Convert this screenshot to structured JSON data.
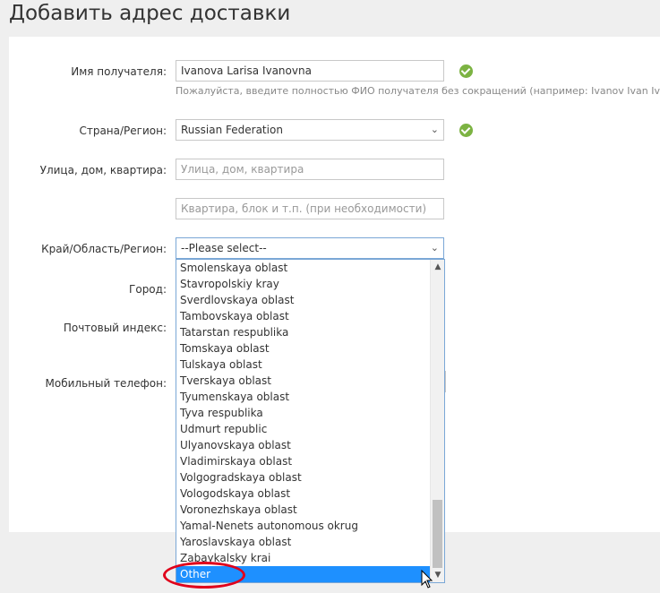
{
  "page_title": "Добавить адрес доставки",
  "form": {
    "name": {
      "label": "Имя получателя:",
      "value": "Ivanova Larisa Ivanovna",
      "hint": "Пожалуйста, введите полностью ФИО получателя без сокращений (например: Ivanov Ivan Iva"
    },
    "country": {
      "label": "Страна/Регион:",
      "value": "Russian Federation"
    },
    "street": {
      "label": "Улица, дом, квартира:",
      "placeholder": "Улица, дом, квартира"
    },
    "apartment": {
      "placeholder": "Квартира, блок и т.п. (при необходимости)"
    },
    "region": {
      "label": "Край/Область/Регион:",
      "value": "--Please select--",
      "options": [
        "Smolenskaya oblast",
        "Stavropolskiy kray",
        "Sverdlovskaya oblast",
        "Tambovskaya oblast",
        "Tatarstan respublika",
        "Tomskaya oblast",
        "Tulskaya oblast",
        "Tverskaya oblast",
        "Tyumenskaya oblast",
        "Tyva respublika",
        "Udmurt republic",
        "Ulyanovskaya oblast",
        "Vladimirskaya oblast",
        "Volgogradskaya oblast",
        "Vologodskaya oblast",
        "Voronezhskaya oblast",
        "Yamal-Nenets autonomous okrug",
        "Yaroslavskaya oblast",
        "Zabaykalsky krai",
        "Other"
      ],
      "highlighted_option": "Other"
    },
    "city": {
      "label": "Город:"
    },
    "postcode": {
      "label": "Почтовый индекс:"
    },
    "mobile": {
      "label": "Мобильный телефон:"
    }
  },
  "colors": {
    "check": "#7cb342",
    "selection": "#1e90ff",
    "annotation": "#e0001b"
  }
}
